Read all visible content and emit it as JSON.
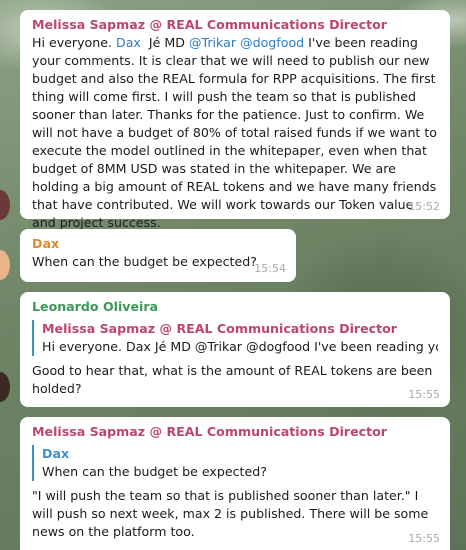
{
  "messages": [
    {
      "sender": "Melissa Sapmaz @ REAL Communications Director",
      "text_lead": "Hi everyone. ",
      "mention1": "Dax",
      "text_mid": "  Jé MD ",
      "mention2": "@Trikar",
      "text_mid2": " ",
      "mention3": "@dogfood",
      "text_body": " I've been reading your comments. It is clear that we will need to publish our new budget and also the REAL formula for RPP acquisitions. The first thing will come first. I will push the team so that is published sooner than later. Thanks for the patience. Just to confirm. We will not have a budget of 80% of total raised funds if we want to execute the model outlined in the whitepaper, even when that budget of 8MM USD was stated in the whitepaper. We are holding a big amount of REAL tokens and we have many friends that have contributed. We will work towards our Token value and project success.",
      "time": "15:52"
    },
    {
      "sender": "Dax",
      "text": "When can the budget be expected?",
      "time": "15:54"
    },
    {
      "sender": "Leonardo Oliveira",
      "reply_author": "Melissa Sapmaz @ REAL Communications Director",
      "reply_text": "Hi everyone. Dax  Jé MD @Trikar @dogfood I've been reading yo...",
      "text": "Good to hear that, what is the amount of REAL tokens are been holded?",
      "time": "15:55"
    },
    {
      "sender": "Melissa Sapmaz @ REAL Communications Director",
      "reply_author": "Dax",
      "reply_text": "When can the budget be expected?",
      "text": "\"I will push the team so that is published sooner than later.\" I will push so next week, max 2 is published. There will be some news on the platform too.",
      "time": "15:55"
    }
  ],
  "colors": {
    "melissa": "#c0456b",
    "dax": "#d98a2e",
    "leonardo": "#3a9a55",
    "mention": "#2e7bbf",
    "reply_bar": "#3a8fd0"
  }
}
